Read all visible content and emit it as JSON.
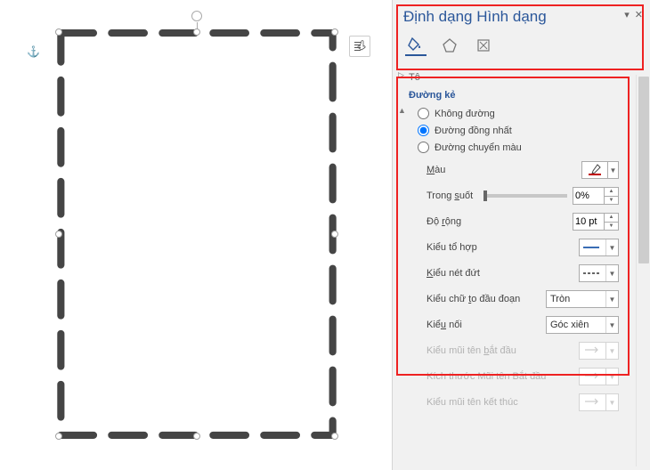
{
  "panel": {
    "title": "Định dạng Hình dạng",
    "sections": {
      "fill": "Tô",
      "line": "Đường kẻ"
    },
    "line_options": {
      "none": "Không đường",
      "solid": "Đường đồng nhất",
      "gradient": "Đường chuyển màu",
      "selected": "solid"
    },
    "props": {
      "color": "Màu",
      "transparency": "Trong suốt",
      "transparency_val": "0%",
      "width": "Độ rộng",
      "width_val": "10 pt",
      "compound": "Kiểu tổ hợp",
      "dash": "Kiểu nét đứt",
      "cap": "Kiểu chữ to đầu đoạn",
      "cap_val": "Tròn",
      "join": "Kiểu nối",
      "join_val": "Góc xiên",
      "arrow_begin": "Kiểu mũi tên bắt đầu",
      "arrow_begin_size": "Kích thước Mũi tên Bắt đầu",
      "arrow_end": "Kiểu mũi tên kết thúc"
    }
  }
}
